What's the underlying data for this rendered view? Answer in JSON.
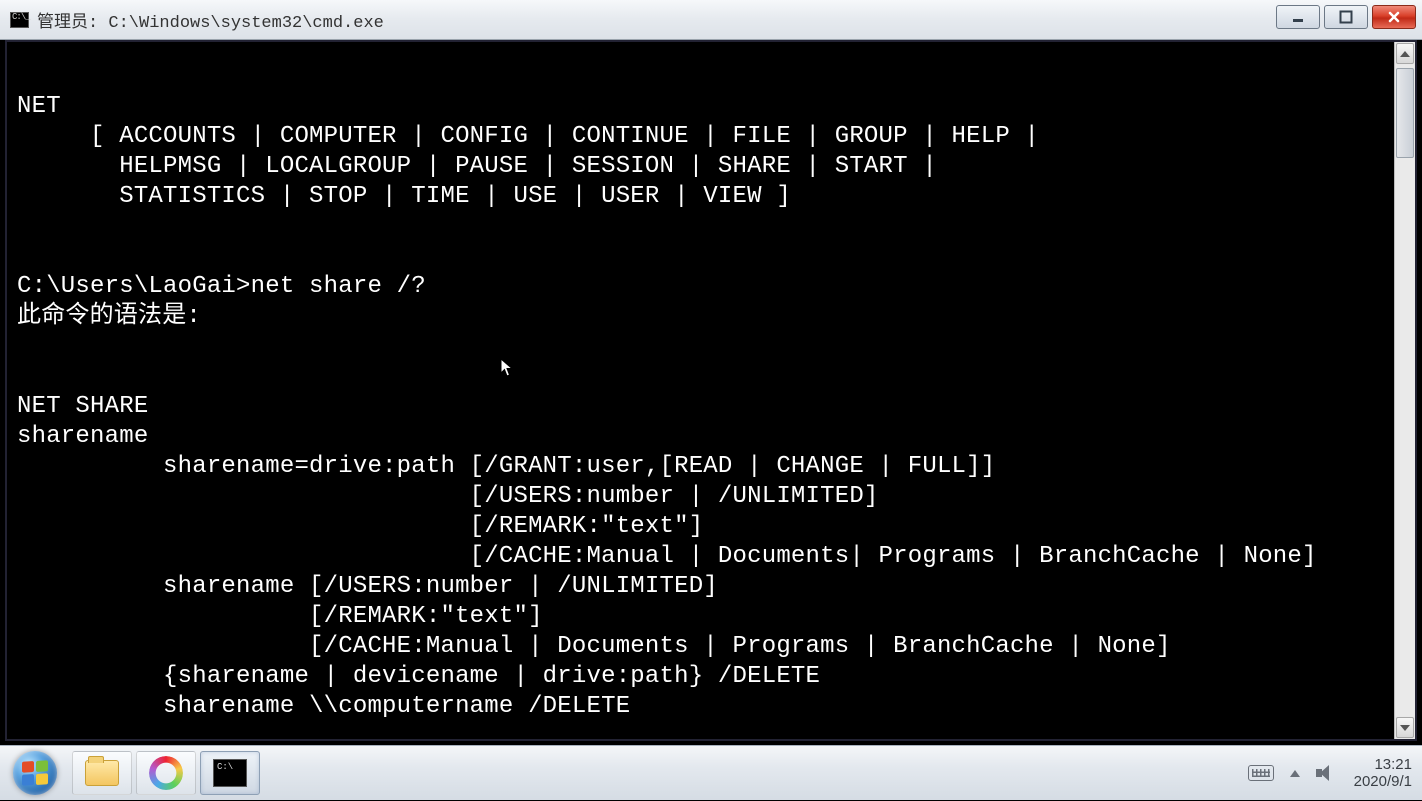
{
  "window": {
    "title": "管理员: C:\\Windows\\system32\\cmd.exe"
  },
  "console": {
    "lines": [
      "",
      "NET",
      "     [ ACCOUNTS | COMPUTER | CONFIG | CONTINUE | FILE | GROUP | HELP |",
      "       HELPMSG | LOCALGROUP | PAUSE | SESSION | SHARE | START |",
      "       STATISTICS | STOP | TIME | USE | USER | VIEW ]",
      "",
      "",
      "C:\\Users\\LaoGai>net share /?",
      "此命令的语法是:",
      "",
      "",
      "NET SHARE",
      "sharename",
      "          sharename=drive:path [/GRANT:user,[READ | CHANGE | FULL]]",
      "                               [/USERS:number | /UNLIMITED]",
      "                               [/REMARK:\"text\"]",
      "                               [/CACHE:Manual | Documents| Programs | BranchCache | None]",
      "          sharename [/USERS:number | /UNLIMITED]",
      "                    [/REMARK:\"text\"]",
      "                    [/CACHE:Manual | Documents | Programs | BranchCache | None]",
      "          {sharename | devicename | drive:path} /DELETE",
      "          sharename \\\\computername /DELETE",
      ""
    ],
    "prompt": "C:\\Users\\LaoGai>"
  },
  "taskbar": {
    "items": [
      {
        "name": "start",
        "icon": "windows-orb"
      },
      {
        "name": "explorer",
        "icon": "folder"
      },
      {
        "name": "color-app",
        "icon": "ring"
      },
      {
        "name": "cmd",
        "icon": "cmd",
        "active": true
      }
    ]
  },
  "tray": {
    "time": "13:21",
    "date": "2020/9/1"
  }
}
